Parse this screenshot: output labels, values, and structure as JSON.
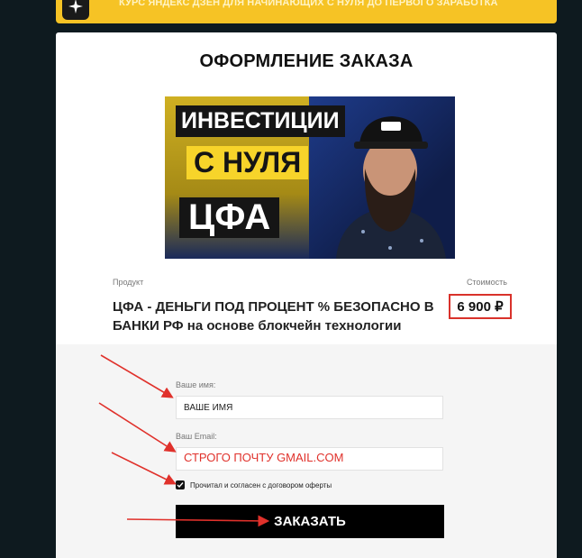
{
  "banner": {
    "text": "КУРС ЯНДЕКС ДЗЕН ДЛЯ НАЧИНАЮЩИХ С НУЛЯ ДО ПЕРВОГО ЗАРАБОТКА",
    "icon": "star-logo-icon"
  },
  "page": {
    "title": "ОФОРМЛЕНИЕ ЗАКАЗА"
  },
  "thumbnail": {
    "line1": "ИНВЕСТИЦИИ",
    "line2": "С НУЛЯ",
    "line3": "ЦФА"
  },
  "product": {
    "label": "Продукт",
    "name": "ЦФА - ДЕНЬГИ ПОД ПРОЦЕНТ % БЕЗОПАСНО В БАНКИ РФ на основе блокчейн технологии",
    "price_label": "Стоимость",
    "price": "6 900 ₽"
  },
  "form": {
    "name_label": "Ваше имя:",
    "name_placeholder": "ВАШЕ ИМЯ",
    "email_label": "Ваш Email:",
    "email_placeholder": "СТРОГО ПОЧТУ GMAIL.COM",
    "agree_label": "Прочитал и согласен с договором оферты",
    "agree_checked": true,
    "submit_label": "ЗАКАЗАТЬ"
  },
  "colors": {
    "banner": "#f6c325",
    "accent_red": "#d9322b",
    "button": "#000000"
  }
}
